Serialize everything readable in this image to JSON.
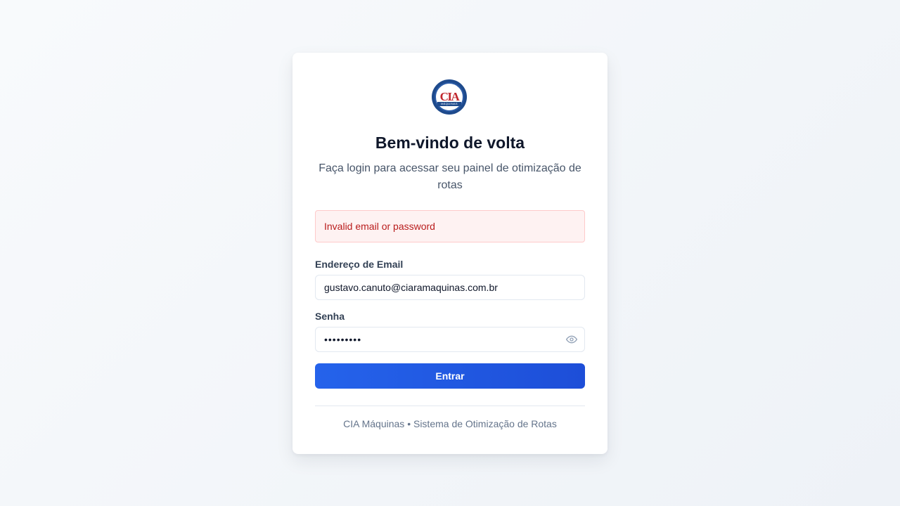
{
  "logo": {
    "letters": "CIA",
    "band_text": "MÁQUINAS",
    "icon": "cia-maquinas-logo"
  },
  "header": {
    "title": "Bem-vindo de volta",
    "subtitle": "Faça login para acessar seu painel de otimização de rotas"
  },
  "alert": {
    "message": "Invalid email or password"
  },
  "form": {
    "email_label": "Endereço de Email",
    "email_value": "gustavo.canuto@ciaramaquinas.com.br",
    "password_label": "Senha",
    "password_value": "•••••••••",
    "password_toggle_icon": "eye-icon",
    "submit_label": "Entrar"
  },
  "footer": {
    "text": "CIA Máquinas • Sistema de Otimização de Rotas"
  },
  "colors": {
    "primary": "#2563eb",
    "error_text": "#b91c1c",
    "error_bg": "#fef2f2"
  }
}
